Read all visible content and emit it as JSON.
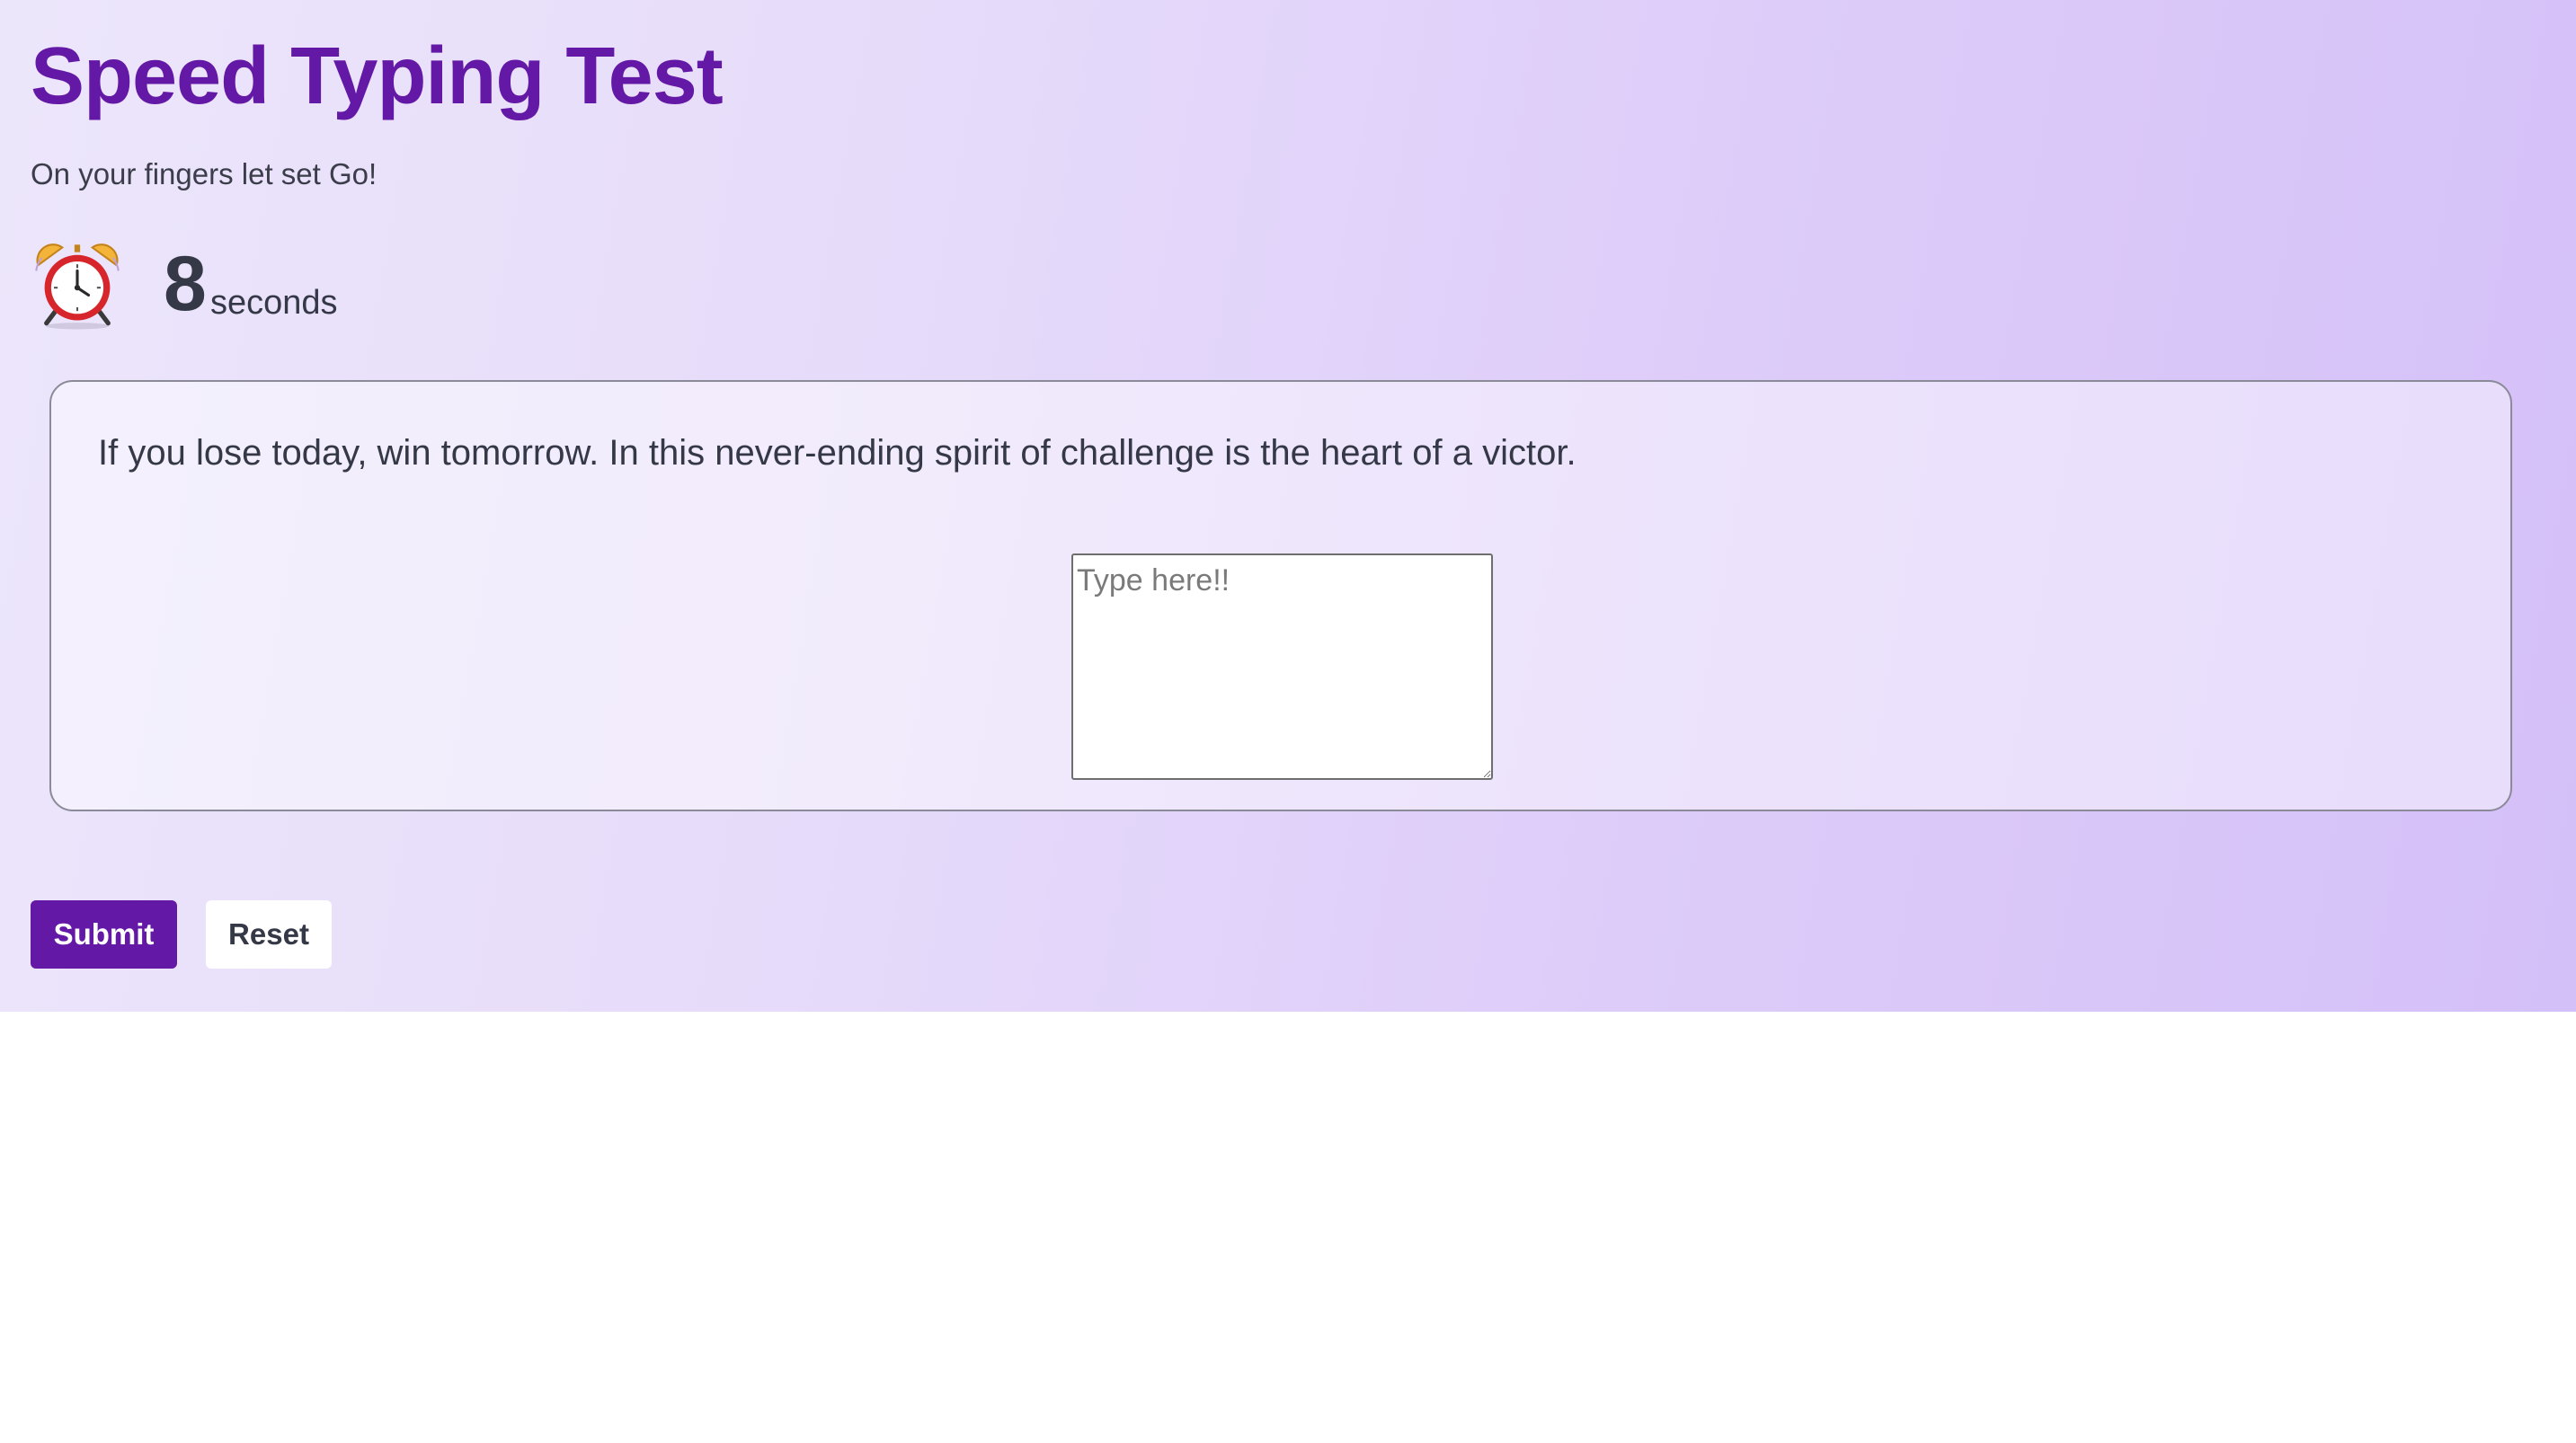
{
  "header": {
    "title": "Speed Typing Test",
    "subtitle": "On your fingers let set Go!"
  },
  "timer": {
    "icon": "alarm-clock-icon",
    "value": "8",
    "unit": "seconds"
  },
  "test": {
    "quote": "If you lose today, win tomorrow. In this never-ending spirit of challenge is the heart of a victor.",
    "input_value": "",
    "input_placeholder": "Type here!!"
  },
  "actions": {
    "submit_label": "Submit",
    "reset_label": "Reset"
  },
  "colors": {
    "accent": "#6419a6",
    "text": "#353947",
    "background_start": "#ece6fb",
    "background_end": "#d4c0f8"
  }
}
